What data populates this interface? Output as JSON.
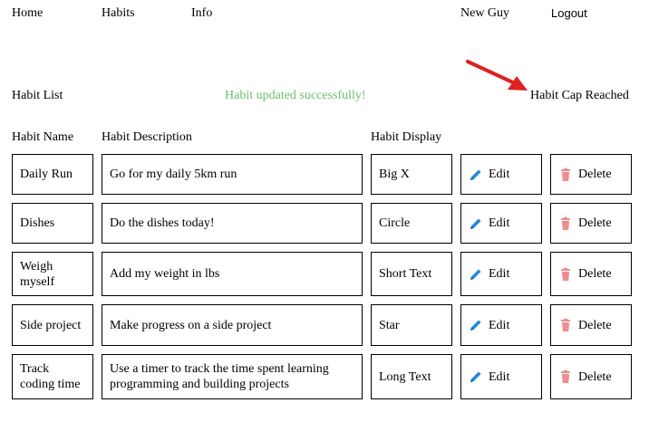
{
  "nav": {
    "home": "Home",
    "habits": "Habits",
    "info": "Info",
    "user": "New Guy",
    "logout": "Logout"
  },
  "header": {
    "title": "Habit List",
    "success_message": "Habit updated successfully!",
    "cap_message": "Habit Cap Reached"
  },
  "colors": {
    "success": "#6cbf6c",
    "annotation_arrow": "#e02020",
    "edit_icon": "#1e88e5",
    "delete_icon": "#f28b8b"
  },
  "table": {
    "columns": [
      "Habit Name",
      "Habit Description",
      "Habit Display"
    ],
    "rows": [
      {
        "name": "Daily Run",
        "description": "Go for my daily 5km run",
        "display": "Big X",
        "edit": "Edit",
        "delete": "Delete"
      },
      {
        "name": "Dishes",
        "description": "Do the dishes today!",
        "display": "Circle",
        "edit": "Edit",
        "delete": "Delete"
      },
      {
        "name": "Weigh myself",
        "description": "Add my weight in lbs",
        "display": "Short Text",
        "edit": "Edit",
        "delete": "Delete"
      },
      {
        "name": "Side project",
        "description": "Make progress on a side project",
        "display": "Star",
        "edit": "Edit",
        "delete": "Delete"
      },
      {
        "name": "Track coding time",
        "description": "Use a timer to track the time spent learning programming and building projects",
        "display": "Long Text",
        "edit": "Edit",
        "delete": "Delete"
      }
    ]
  }
}
